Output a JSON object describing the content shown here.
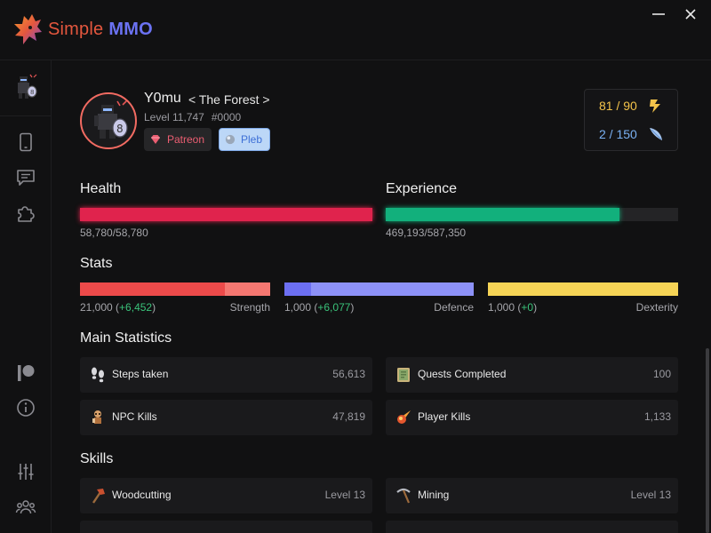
{
  "app": {
    "title_part1": "Simple",
    "title_part2": "MMO"
  },
  "profile": {
    "username": "Y0mu",
    "location": "< The Forest >",
    "level": "Level 11,747",
    "id": "#0000",
    "badges": [
      {
        "label": "Patreon",
        "color": "#ec5e72"
      },
      {
        "label": "Pleb",
        "color": "#3d6fd6"
      }
    ]
  },
  "resources": {
    "energy": "81 / 90",
    "quest_points": "2 / 150"
  },
  "health": {
    "title": "Health",
    "text": "58,780/58,780",
    "current": 58780,
    "max": 58780,
    "color": "#e0234d"
  },
  "experience": {
    "title": "Experience",
    "text": "469,193/587,350",
    "current": 469193,
    "max": 587350,
    "color": "#12b07c"
  },
  "stats": {
    "title": "Stats",
    "items": [
      {
        "name": "Strength",
        "base": "21,000",
        "bonus": "+6,452",
        "base_fraction": 0.76,
        "base_color": "#ec4a4a",
        "bonus_color": "#f47771"
      },
      {
        "name": "Defence",
        "base": "1,000",
        "bonus": "+6,077",
        "base_fraction": 0.14,
        "base_color": "#6c6ff2",
        "bonus_color": "#8d91f7"
      },
      {
        "name": "Dexterity",
        "base": "1,000",
        "bonus": "+0",
        "base_fraction": 1.0,
        "base_color": "#f6d456",
        "bonus_color": "#f6d456"
      }
    ]
  },
  "main_statistics": {
    "title": "Main Statistics",
    "items": [
      {
        "label": "Steps taken",
        "value": "56,613",
        "icon": "footsteps-icon"
      },
      {
        "label": "Quests Completed",
        "value": "100",
        "icon": "quest-scroll-icon"
      },
      {
        "label": "NPC Kills",
        "value": "47,819",
        "icon": "npc-icon"
      },
      {
        "label": "Player Kills",
        "value": "1,133",
        "icon": "meteor-icon"
      }
    ]
  },
  "skills": {
    "title": "Skills",
    "items": [
      {
        "label": "Woodcutting",
        "value": "Level 13",
        "icon": "axe-icon"
      },
      {
        "label": "Mining",
        "value": "Level 13",
        "icon": "pickaxe-icon"
      }
    ]
  }
}
